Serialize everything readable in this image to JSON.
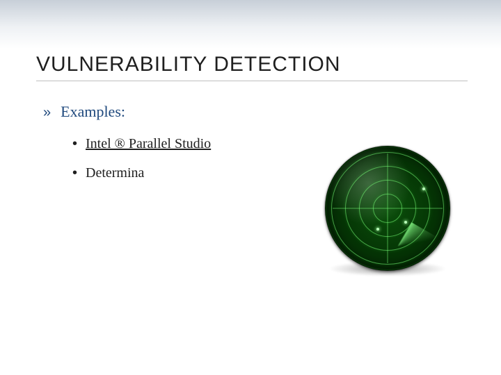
{
  "title": "VULNERABILITY DETECTION",
  "bullets": {
    "l1": {
      "marker": "»",
      "text": "Examples:"
    },
    "l2": [
      {
        "marker": "•",
        "text": "Intel ® Parallel Studio",
        "link": true
      },
      {
        "marker": "•",
        "text": "Determina",
        "link": false
      }
    ]
  },
  "image": {
    "name": "radar-scope-illustration"
  }
}
